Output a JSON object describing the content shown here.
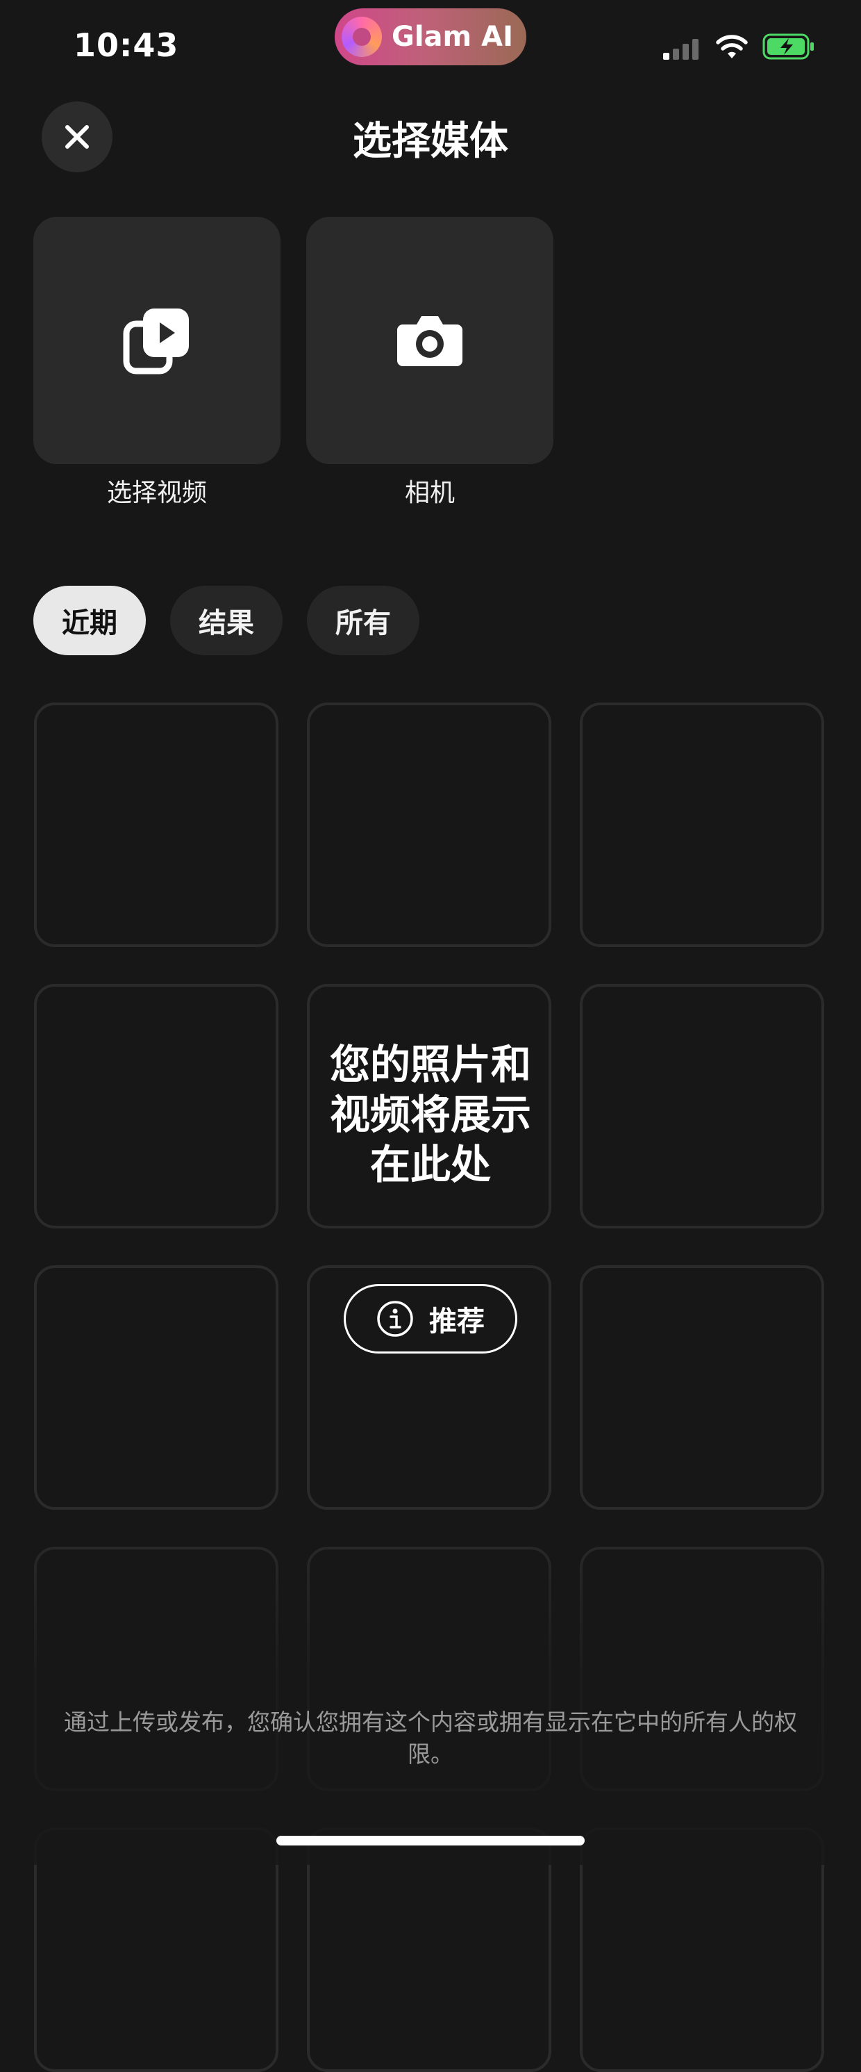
{
  "status_bar": {
    "time": "10:43",
    "app_pill_label": "Glam AI",
    "battery_color": "#4cd964"
  },
  "header": {
    "title": "选择媒体"
  },
  "sources": [
    {
      "label": "选择视频",
      "icon": "video-library-icon"
    },
    {
      "label": "相机",
      "icon": "camera-icon"
    }
  ],
  "filters": [
    {
      "label": "近期",
      "active": true
    },
    {
      "label": "结果",
      "active": false
    },
    {
      "label": "所有",
      "active": false
    }
  ],
  "empty_state": {
    "message": "您的照片和视频将展示在此处",
    "tips_button_label": "推荐",
    "tips_icon": "info-icon"
  },
  "footer": {
    "legal_text": "通过上传或发布，您确认您拥有这个内容或拥有显示在它中的所有人的权限。"
  },
  "colors": {
    "background": "#171717",
    "card": "#2a2a2a",
    "chip": "#262626",
    "chip_active": "#e8e8e8"
  }
}
